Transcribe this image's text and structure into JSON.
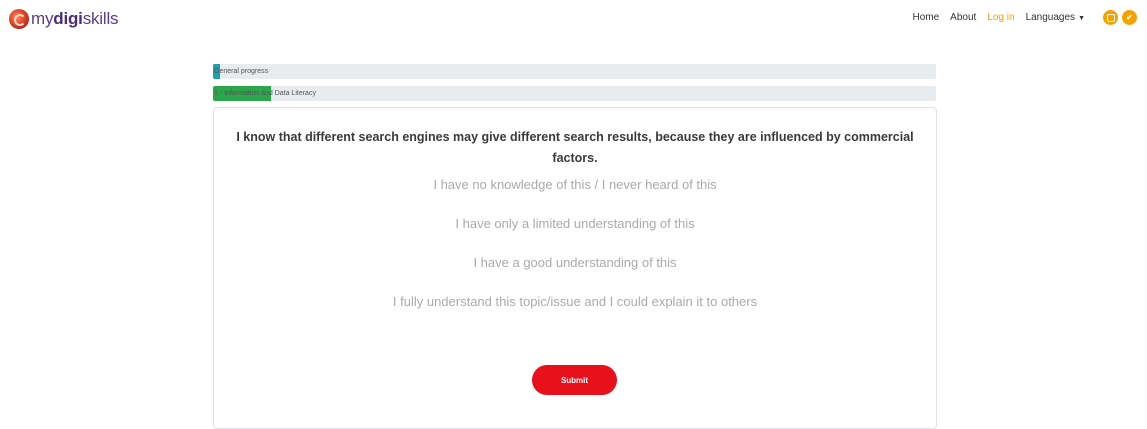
{
  "brand": {
    "name_prefix": "my",
    "name_bold": "digi",
    "name_suffix": "skills"
  },
  "nav": {
    "items": [
      {
        "label": "Home"
      },
      {
        "label": "About"
      },
      {
        "label": "Log in"
      },
      {
        "label": "Languages"
      }
    ],
    "social_icons": [
      "instagram-icon",
      "twitter-icon"
    ]
  },
  "progress": {
    "general": {
      "label": "General progress",
      "value": 0.01,
      "color": "#1a9fb3"
    },
    "area": {
      "label": "1 - Information and Data Literacy",
      "value": 0.08,
      "color": "#2ba64a"
    }
  },
  "question": {
    "text": "I know that different search engines may give different search results, because they are influenced by commercial factors.",
    "options": [
      "I have no knowledge of this / I never heard of this",
      "I have only a limited understanding of this",
      "I have a good understanding of this",
      "I fully understand this topic/issue and I could explain it to others"
    ]
  },
  "submit_label": "Submit",
  "colors": {
    "accent": "#f5a100",
    "submit": "#e8101b",
    "brand": "#4a2c7c"
  }
}
